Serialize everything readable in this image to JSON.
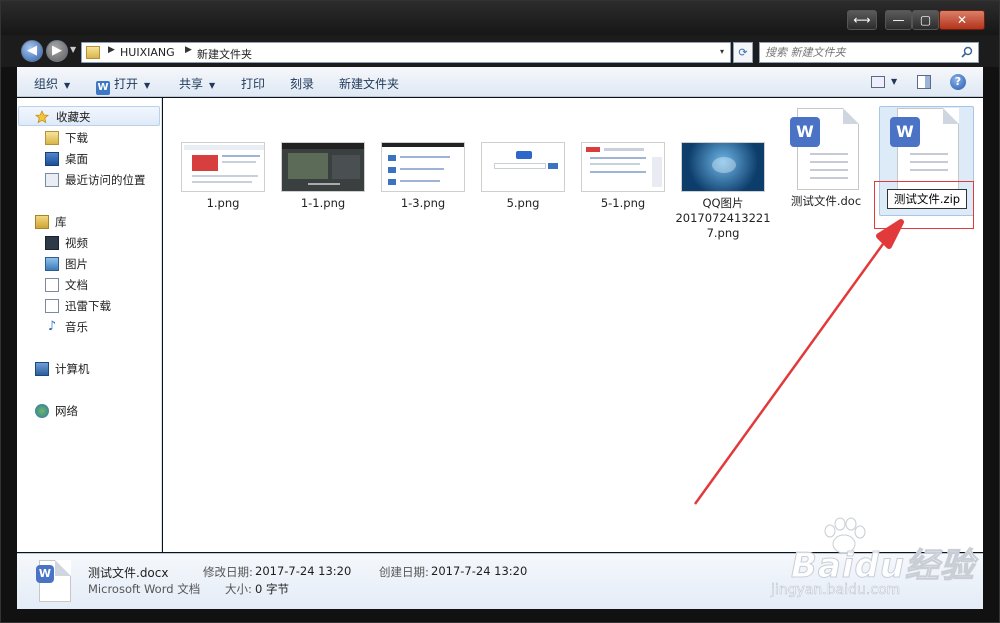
{
  "window": {
    "controls": {
      "resize": "⟷",
      "minimize": "—",
      "maximize": "▢",
      "close": "✕"
    }
  },
  "address": {
    "segments": [
      "HUIXIANG",
      "新建文件夹"
    ],
    "dropdown": "▾"
  },
  "search": {
    "placeholder": "搜索 新建文件夹"
  },
  "toolbar": {
    "organize": "组织",
    "open": "打开",
    "open_icon": "W",
    "share": "共享",
    "print": "打印",
    "burn": "刻录",
    "new_folder": "新建文件夹",
    "help": "?"
  },
  "nav": {
    "favorites": "收藏夹",
    "downloads": "下载",
    "desktop": "桌面",
    "recent": "最近访问的位置",
    "libraries": "库",
    "videos": "视频",
    "pictures": "图片",
    "documents": "文档",
    "xunlei": "迅雷下载",
    "music": "音乐",
    "computer": "计算机",
    "network": "网络"
  },
  "files": [
    {
      "name": "1.png"
    },
    {
      "name": "1-1.png"
    },
    {
      "name": "1-3.png"
    },
    {
      "name": "5.png"
    },
    {
      "name": "5-1.png"
    },
    {
      "name_line1": "QQ图片",
      "name_line2": "2017072413221",
      "name_line3": "7.png"
    },
    {
      "name": "测试文件.doc",
      "badge": "W"
    },
    {
      "name": "测试文件.zip",
      "badge": "W",
      "renaming": true
    }
  ],
  "details": {
    "file_name": "测试文件.docx",
    "file_type": "Microsoft Word 文档",
    "badge": "W",
    "modified_label": "修改日期:",
    "modified_value": "2017-7-24 13:20",
    "created_label": "创建日期:",
    "created_value": "2017-7-24 13:20",
    "size_label": "大小:",
    "size_value": "0 字节"
  },
  "watermark": {
    "brand": "Baidu经验",
    "url": "jingyan.baidu.com"
  },
  "colors": {
    "accent": "#3e78c4",
    "annotation": "#e23a3a",
    "word_badge": "#4a73c6"
  }
}
